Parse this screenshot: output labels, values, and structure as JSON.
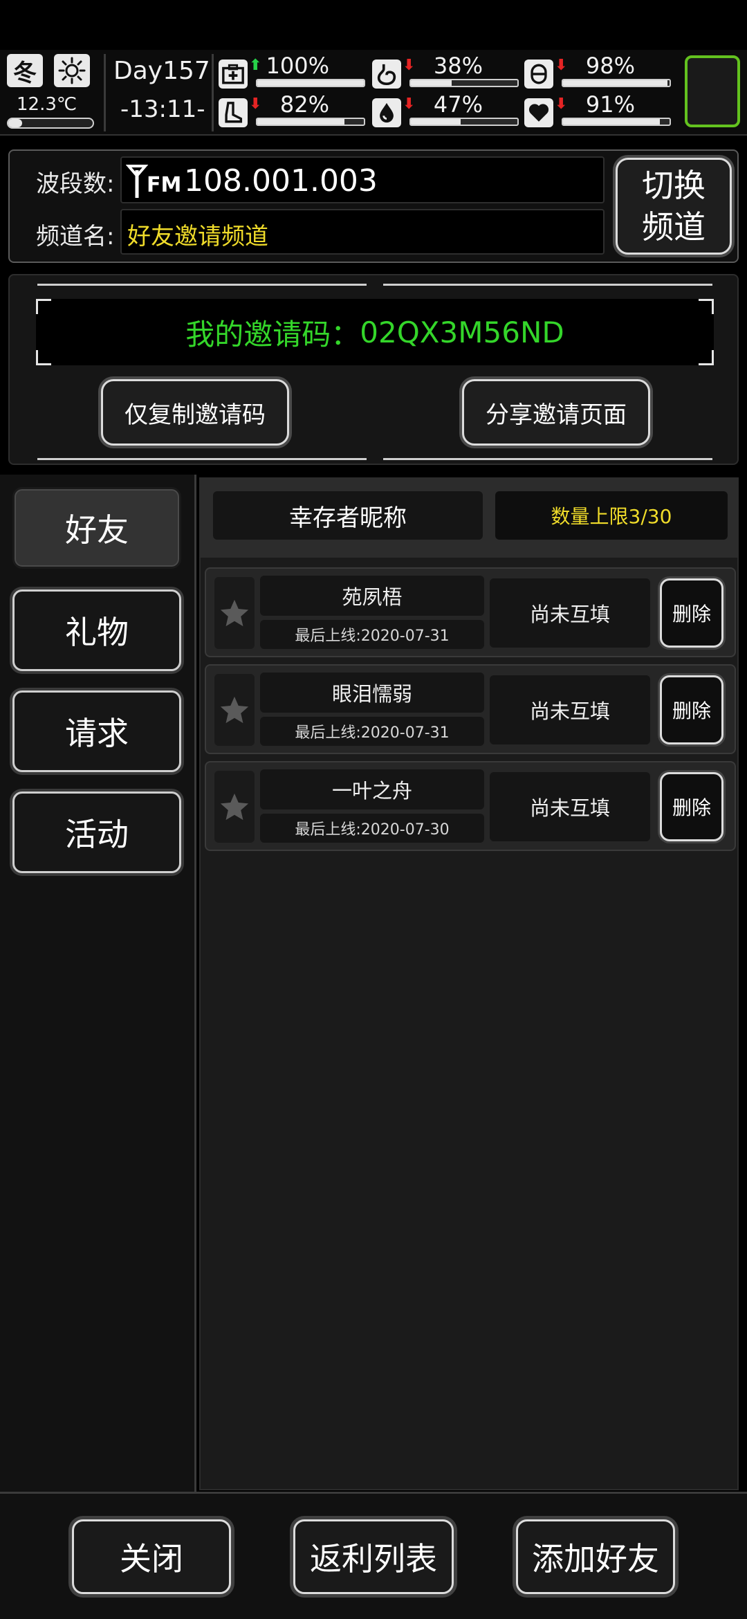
{
  "status": {
    "season": "冬",
    "weather_icon": "sun-icon",
    "temperature": "12.3℃",
    "day": "Day157",
    "time": "-13:11-",
    "stats": [
      {
        "icon": "medkit-icon",
        "trend": "up",
        "percent": "100%",
        "level": 1.0
      },
      {
        "icon": "stomach-icon",
        "trend": "down",
        "percent": "38%",
        "level": 0.38
      },
      {
        "icon": "bladder-icon",
        "trend": "down",
        "percent": "98%",
        "level": 0.98
      },
      {
        "icon": "foot-icon",
        "trend": "down",
        "percent": "82%",
        "level": 0.82
      },
      {
        "icon": "water-drop-icon",
        "trend": "down",
        "percent": "47%",
        "level": 0.47
      },
      {
        "icon": "heart-icon",
        "trend": "down",
        "percent": "91%",
        "level": 0.91
      }
    ],
    "accent_green": "#63c21f"
  },
  "radio": {
    "band_label": "波段数:",
    "fm_tag": "FM",
    "band_value": "108.001.003",
    "channel_label": "频道名:",
    "channel_value": "好友邀请频道",
    "switch_button": [
      "切换",
      "频道"
    ]
  },
  "invite": {
    "code_label": "我的邀请码：",
    "code": "02QX3M56ND",
    "copy_button": "仅复制邀请码",
    "share_button": "分享邀请页面",
    "code_color": "#34d62a"
  },
  "tabs": [
    {
      "label": "好友",
      "active": true
    },
    {
      "label": "礼物",
      "active": false
    },
    {
      "label": "请求",
      "active": false
    },
    {
      "label": "活动",
      "active": false
    }
  ],
  "list": {
    "header_name": "幸存者昵称",
    "header_limit": "数量上限3/30",
    "limit_color": "#f0dc2a",
    "rows": [
      {
        "name": "苑夙梧",
        "last_online": "最后上线:2020-07-31",
        "status": "尚未互填",
        "delete": "删除"
      },
      {
        "name": "眼泪懦弱",
        "last_online": "最后上线:2020-07-31",
        "status": "尚未互填",
        "delete": "删除"
      },
      {
        "name": "一叶之舟",
        "last_online": "最后上线:2020-07-30",
        "status": "尚未互填",
        "delete": "删除"
      }
    ]
  },
  "footer": {
    "close": "关闭",
    "rebate": "返利列表",
    "add_friend": "添加好友"
  }
}
